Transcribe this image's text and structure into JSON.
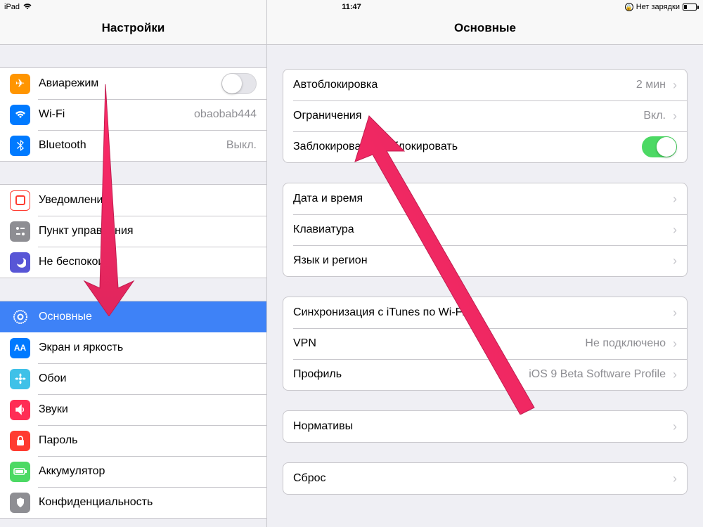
{
  "status": {
    "device": "iPad",
    "time": "11:47",
    "charge_text": "Нет зарядки"
  },
  "sidebar": {
    "title": "Настройки",
    "g1": {
      "airplane": "Авиарежим",
      "wifi": "Wi-Fi",
      "wifi_value": "obaobab444",
      "bt": "Bluetooth",
      "bt_value": "Выкл."
    },
    "g2": {
      "notif": "Уведомления",
      "control": "Пункт управления",
      "dnd": "Не беспокоить"
    },
    "g3": {
      "general": "Основные",
      "display": "Экран и яркость",
      "wallpaper": "Обои",
      "sounds": "Звуки",
      "passcode": "Пароль",
      "battery": "Аккумулятор",
      "privacy": "Конфиденциальность"
    }
  },
  "detail": {
    "title": "Основные",
    "g1": {
      "autolock": "Автоблокировка",
      "autolock_value": "2 мин",
      "restrictions": "Ограничения",
      "restrictions_value": "Вкл.",
      "lockunlock": "Заблокировать/разблокировать"
    },
    "g2": {
      "datetime": "Дата и время",
      "keyboard": "Клавиатура",
      "lang": "Язык и регион"
    },
    "g3": {
      "itunes": "Синхронизация с iTunes по Wi-Fi",
      "vpn": "VPN",
      "vpn_value": "Не подключено",
      "profile": "Профиль",
      "profile_value": "iOS 9 Beta Software Profile"
    },
    "g4": {
      "regulatory": "Нормативы"
    },
    "g5": {
      "reset": "Сброс"
    }
  }
}
